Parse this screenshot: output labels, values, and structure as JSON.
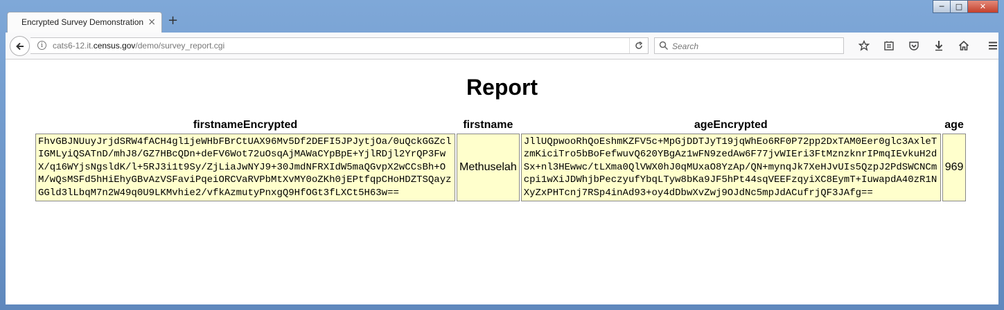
{
  "browser": {
    "tab_title": "Encrypted Survey Demonstration",
    "tab_close_glyph": "×",
    "new_tab_glyph": "+",
    "url_prefix": "cats6-12.it.",
    "url_host": "census.gov",
    "url_path": "/demo/survey_report.cgi",
    "search_placeholder": "Search",
    "window_controls": [
      "─",
      "□",
      "✕"
    ],
    "toolbar_icons": [
      "star-icon",
      "reading-list-icon",
      "pocket-icon",
      "download-icon",
      "home-icon",
      "menu-icon"
    ]
  },
  "page": {
    "title": "Report",
    "headers": [
      "firstnameEncrypted",
      "firstname",
      "ageEncrypted",
      "age"
    ],
    "rows": [
      {
        "firstnameEncrypted": "FhvGBJNUuyJrjdSRW4fACH4gl1jeWHbFBrCtUAX96Mv5Df2DEFI5JPJytjOa/0uQckGGZclIGMLyiQSATnD/mhJ8/GZ7HBcQDn+deFV6Wot72uOsqAjMAWaCYpBpE+YjlRDjl2YrQP3FwX/q16WYjsNgsldK/l+5RJ3i1t9Sy/ZjLiaJwNYJ9+30JmdNFRXIdW5maQGvpX2wCCsBh+OM/wQsMSFd5hHiEhyGBvAzVSFaviPqeiORCVaRVPbMtXvMY0oZKh0jEPtfqpCHoHDZTSQayzGGld3lLbqM7n2W49q0U9LKMvhie2/vfkAzmutyPnxgQ9HfOGt3fLXCt5H63w==",
        "firstname": "Methuselah",
        "ageEncrypted": "JllUQpwooRhQoEshmKZFV5c+MpGjDDTJyT19jqWhEo6RF0P72pp2DxTAM0Eer0glc3AxleTzmKiciTro5bBoFefwuvQ620YBgAz1wFN9zedAw6F77jvWIEri3FtMznzknrIPmqIEvkuH2dSx+nl3HEwwc/tLXma0QlVWX0hJ0qMUxaO8YzAp/QN+mynqJk7XeHJvUIs5QzpJ2PdSWCNCmcpi1wXiJDWhjbPeczyufYbqLTyw8bKa9JF5hPt44sqVEEFzqyiXC8EymT+IuwapdA40zR1NXyZxPHTcnj7RSp4inAd93+oy4dDbwXvZwj9OJdNc5mpJdACufrjQF3JAfg==",
        "age": "969"
      }
    ]
  }
}
